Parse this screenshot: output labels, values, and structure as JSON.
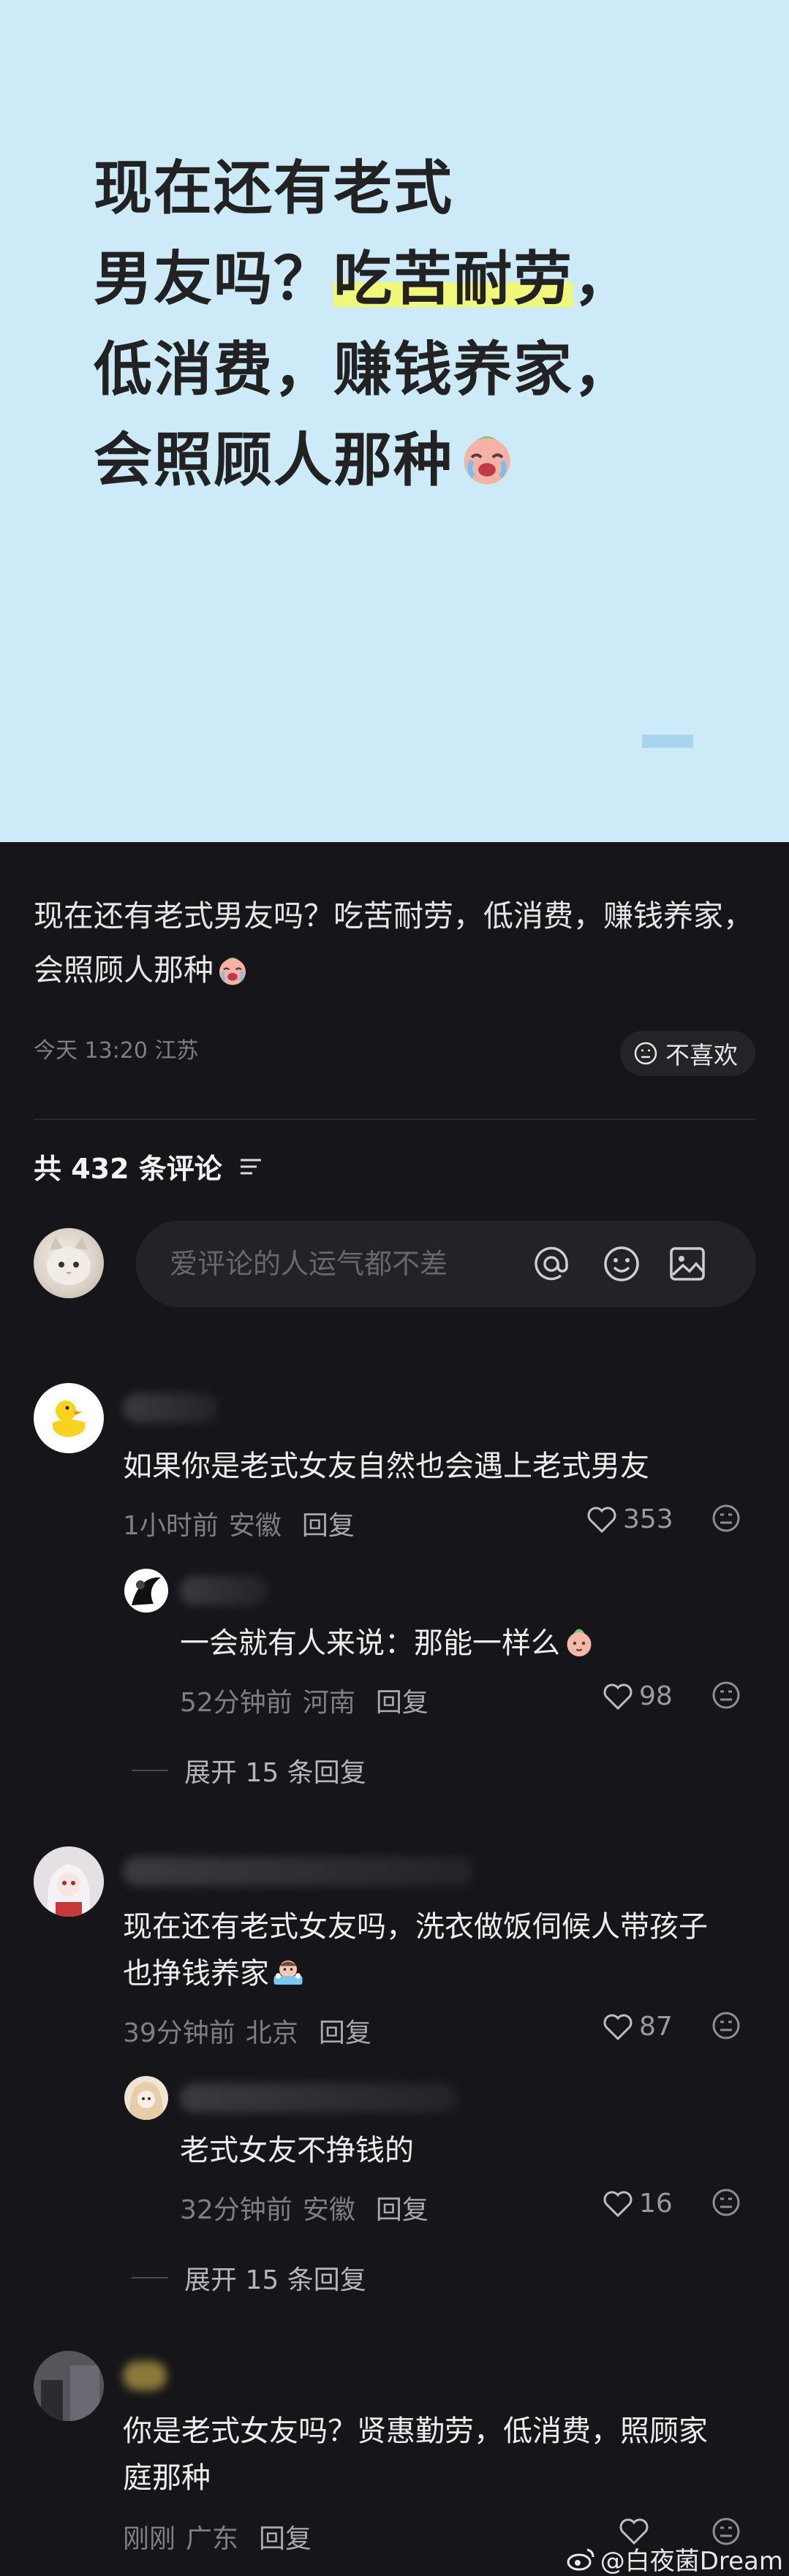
{
  "cover": {
    "line1": "现在还有老式",
    "line2_a": "男友吗？",
    "line2_hl": "吃苦耐劳",
    "line2_b": "，",
    "line3": "低消费，赚钱养家，",
    "line4": "会照顾人那种",
    "emoji": "crying-face"
  },
  "post": {
    "text": "现在还有老式男友吗？吃苦耐劳，低消费，赚钱养家，会照顾人那种",
    "time_location": "今天 13:20  江苏",
    "dislike_label": "不喜欢"
  },
  "comments_header": {
    "count_label": "共 432 条评论",
    "sort_icon": "sort-lines-icon"
  },
  "comment_input": {
    "placeholder": "爱评论的人运气都不差",
    "icons": [
      "at-icon",
      "emoji-icon",
      "image-icon"
    ]
  },
  "comments": [
    {
      "text": "如果你是老式女友自然也会遇上老式男友",
      "time": "1小时前",
      "location": "安徽",
      "reply_label": "回复",
      "likes": "353",
      "replies": [
        {
          "text": "一会就有人来说：那能一样么",
          "time": "52分钟前",
          "location": "河南",
          "reply_label": "回复",
          "likes": "98"
        }
      ],
      "expand_label": "展开 15 条回复"
    },
    {
      "text_line1": "现在还有老式女友吗，洗衣做饭伺候人带孩子",
      "text_line2": "也挣钱养家",
      "time": "39分钟前",
      "location": "北京",
      "reply_label": "回复",
      "likes": "87",
      "replies": [
        {
          "text": "老式女友不挣钱的",
          "time": "32分钟前",
          "location": "安徽",
          "reply_label": "回复",
          "likes": "16"
        }
      ],
      "expand_label": "展开 15 条回复"
    },
    {
      "text_line1": "你是老式女友吗？贤惠勤劳，低消费，照顾家",
      "text_line2": "庭那种",
      "time": "刚刚",
      "location": "广东",
      "reply_label": "回复",
      "likes": ""
    }
  ],
  "watermark": "@白夜菌Dream",
  "colors": {
    "cover_bg": "#cdeaf9",
    "highlight": "#f0f77a",
    "page_bg": "#16161a"
  }
}
